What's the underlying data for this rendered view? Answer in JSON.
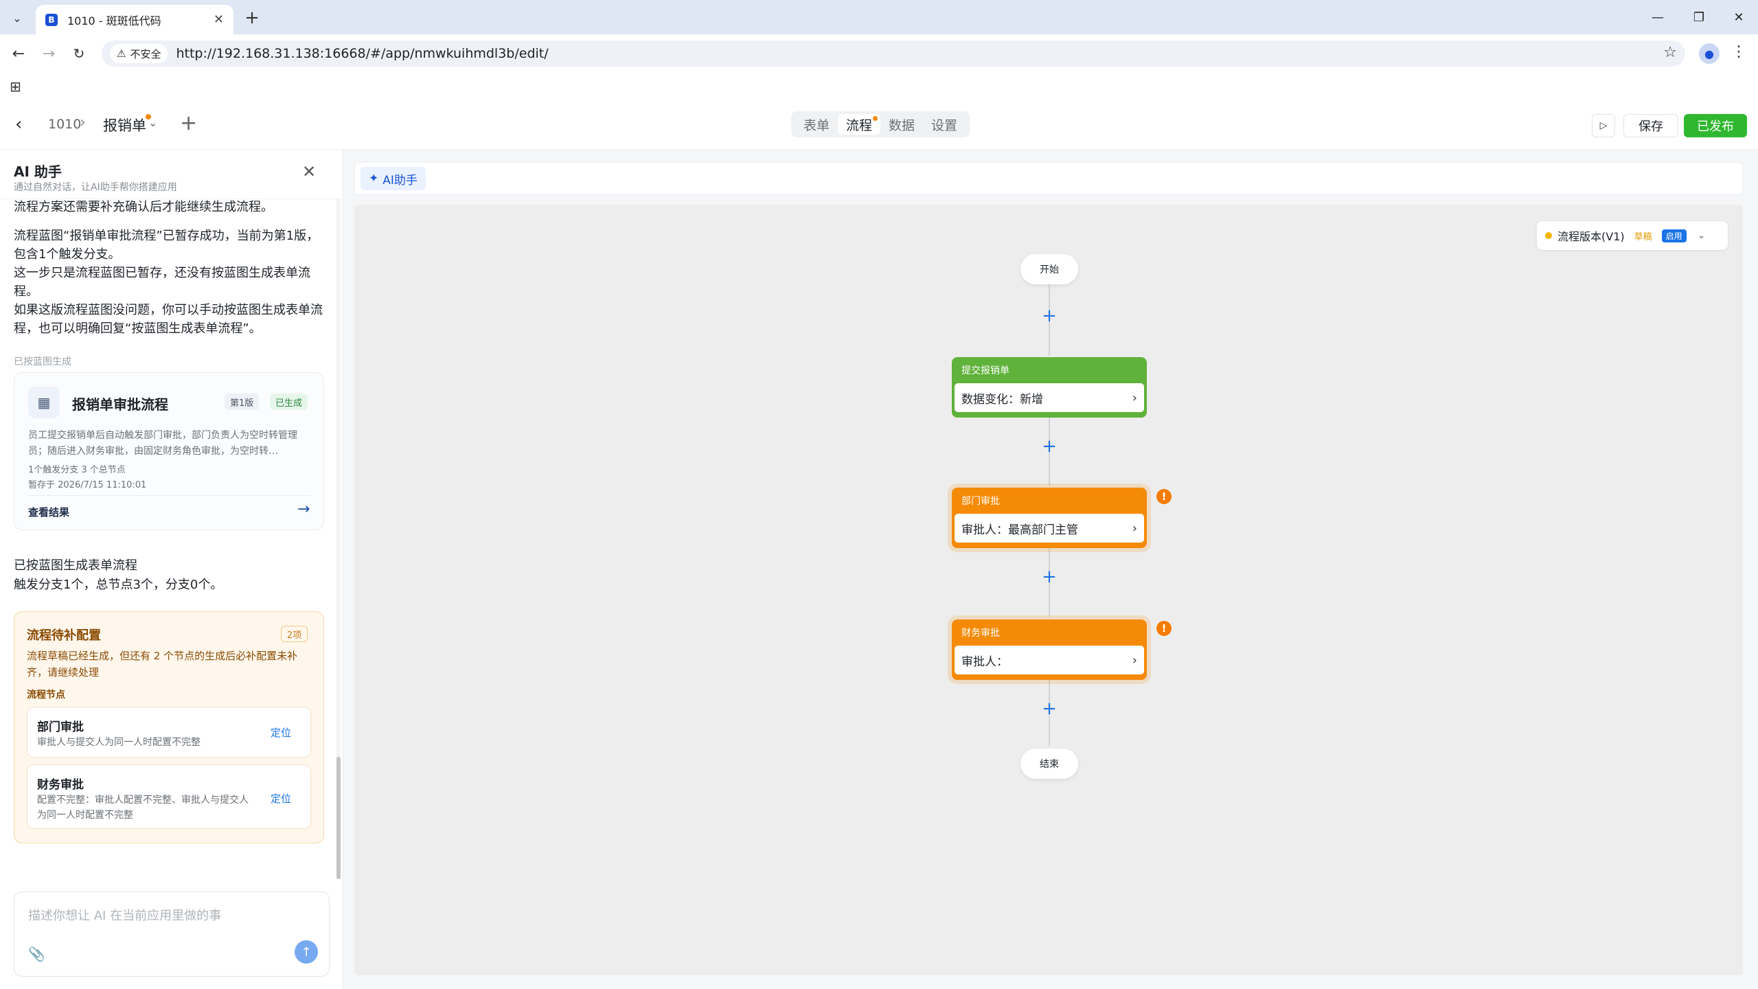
{
  "browser": {
    "tab_title": "1010 - 斑斑低代码",
    "favicon_letter": "B",
    "security_label": "不安全",
    "url": "http://192.168.31.138:16668/#/app/nmwkuihmdl3b/edit/"
  },
  "header": {
    "app_name": "1010",
    "page_name": "报销单",
    "tabs": [
      {
        "label": "表单"
      },
      {
        "label": "流程"
      },
      {
        "label": "数据"
      },
      {
        "label": "设置"
      }
    ],
    "save_label": "保存",
    "publish_label": "已发布"
  },
  "ai_panel": {
    "title": "AI 助手",
    "subtitle": "通过自然对话，让AI助手帮你搭建应用",
    "messages": {
      "m1": "流程方案还需要补充确认后才能继续生成流程。",
      "m2": "流程蓝图“报销单审批流程”已暂存成功，当前为第1版，包含1个触发分支。",
      "m3": "这一步只是流程蓝图已暂存，还没有按蓝图生成表单流程。",
      "m4": "如果这版流程蓝图没问题，你可以手动按蓝图生成表单流程，也可以明确回复“按蓝图生成表单流程”。",
      "m5": "已按蓝图生成表单流程",
      "m6": "触发分支1个，总节点3个，分支0个。"
    },
    "generated_tag": "已按蓝图生成",
    "flow_card": {
      "name": "报销单审批流程",
      "version": "第1版",
      "status": "已生成",
      "description": "员工提交报销单后自动触发部门审批，部门负责人为空时转管理员；随后进入财务审批，由固定财务角色审批，为空时转…",
      "meta": "1个触发分支   3 个总节点",
      "saved_at": "暂存于 2026/7/15 11:10:01",
      "view_label": "查看结果"
    },
    "pending": {
      "title": "流程待补配置",
      "count": "2项",
      "description": "流程草稿已经生成，但还有 2 个节点的生成后必补配置未补齐，请继续处理",
      "section": "流程节点",
      "items": [
        {
          "name": "部门审批",
          "issue": "审批人与提交人为同一人时配置不完整",
          "locate": "定位"
        },
        {
          "name": "财务审批",
          "issue": "配置不完整：审批人配置不完整、审批人与提交人为同一人时配置不完整",
          "locate": "定位"
        }
      ]
    },
    "composer_placeholder": "描述你想让 AI 在当前应用里做的事"
  },
  "canvas": {
    "ai_button": "AI助手",
    "version": {
      "label": "流程版本(V1)",
      "draft": "草稿",
      "enabled": "启用"
    },
    "start_label": "开始",
    "end_label": "结束",
    "nodes": [
      {
        "title": "提交报销单",
        "body": "数据变化：新增",
        "color": "#5fb23a"
      },
      {
        "title": "部门审批",
        "body": "审批人：最高部门主管",
        "color": "#f58a07"
      },
      {
        "title": "财务审批",
        "body": "审批人：",
        "color": "#f58a07"
      }
    ]
  }
}
